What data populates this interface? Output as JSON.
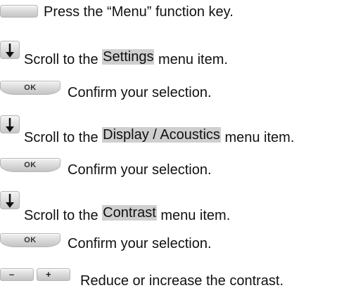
{
  "steps": [
    {
      "key": "menu",
      "text": "Press the “Menu” function key."
    },
    {
      "key": "down-arrow",
      "pre": "Scroll to the ",
      "item": "Settings",
      "post": " menu item."
    },
    {
      "key": "ok",
      "key_label": "OK",
      "text": "Confirm your selection."
    },
    {
      "key": "down-arrow",
      "pre": "Scroll to the ",
      "item": "Display / Acoustics",
      "post": " menu item."
    },
    {
      "key": "ok",
      "key_label": "OK",
      "text": "Confirm your selection."
    },
    {
      "key": "down-arrow",
      "pre": "Scroll to the ",
      "item": "Contrast",
      "post": " menu item."
    },
    {
      "key": "ok",
      "key_label": "OK",
      "text": "Confirm your selection."
    },
    {
      "key": "minus-plus",
      "minus_label": "–",
      "plus_label": "+",
      "text": "Reduce or increase the contrast."
    }
  ],
  "colors": {
    "highlight": "#cfcfcf",
    "key_face": "#d7d7d7"
  }
}
